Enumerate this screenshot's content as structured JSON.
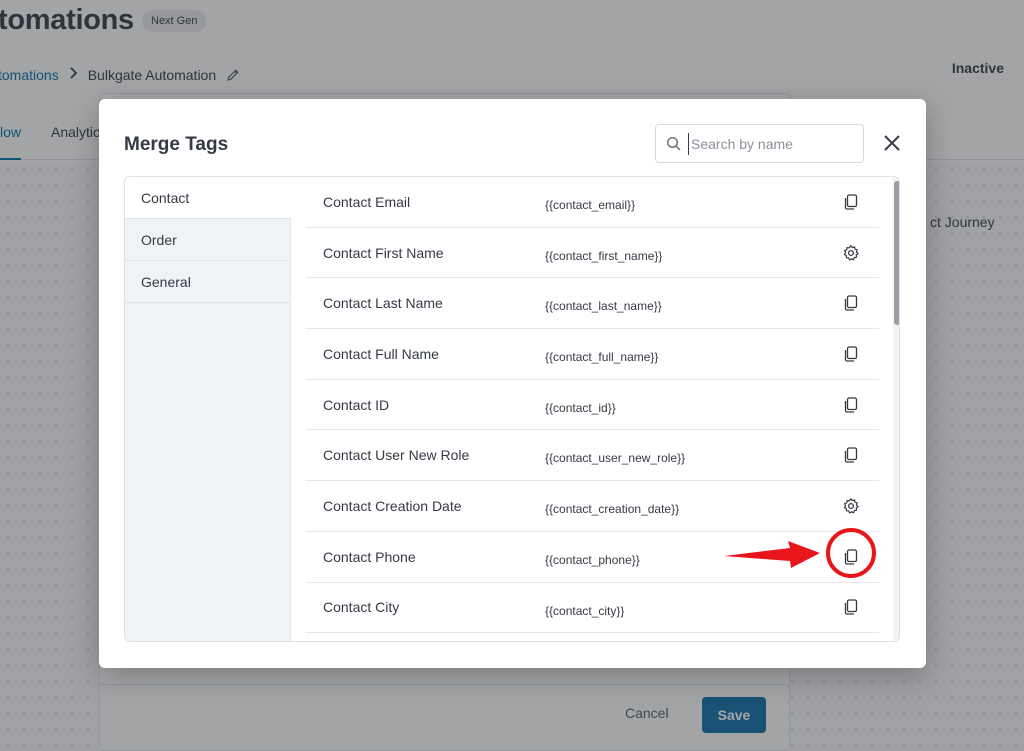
{
  "background": {
    "title": "tomations",
    "badge": "Next Gen",
    "breadcrumb": {
      "parent": "tomations",
      "current": "Bulkgate Automation"
    },
    "status": "Inactive",
    "tabs": [
      {
        "label": "low"
      },
      {
        "label": "Analytic"
      }
    ],
    "canvas_node_text": "ct Journey",
    "footer": {
      "cancel_label": "Cancel",
      "save_label": "Save"
    }
  },
  "modal": {
    "title": "Merge Tags",
    "search": {
      "placeholder": "Search by name",
      "value": ""
    },
    "categories": [
      {
        "label": "Contact",
        "active": true
      },
      {
        "label": "Order",
        "active": false
      },
      {
        "label": "General",
        "active": false
      }
    ],
    "tags": [
      {
        "label": "Contact Email",
        "tag": "{{contact_email}}",
        "icon": "copy-icon"
      },
      {
        "label": "Contact First Name",
        "tag": "{{contact_first_name}}",
        "icon": "gear-icon"
      },
      {
        "label": "Contact Last Name",
        "tag": "{{contact_last_name}}",
        "icon": "copy-icon"
      },
      {
        "label": "Contact Full Name",
        "tag": "{{contact_full_name}}",
        "icon": "copy-icon"
      },
      {
        "label": "Contact ID",
        "tag": "{{contact_id}}",
        "icon": "copy-icon"
      },
      {
        "label": "Contact User New Role",
        "tag": "{{contact_user_new_role}}",
        "icon": "copy-icon"
      },
      {
        "label": "Contact Creation Date",
        "tag": "{{contact_creation_date}}",
        "icon": "gear-icon"
      },
      {
        "label": "Contact Phone",
        "tag": "{{contact_phone}}",
        "icon": "copy-icon",
        "highlighted": true
      },
      {
        "label": "Contact City",
        "tag": "{{contact_city}}",
        "icon": "copy-icon"
      }
    ]
  },
  "colors": {
    "primary": "#0e6fa8",
    "link": "#0073aa",
    "text": "#353a45",
    "annotation": "#e8151b"
  }
}
